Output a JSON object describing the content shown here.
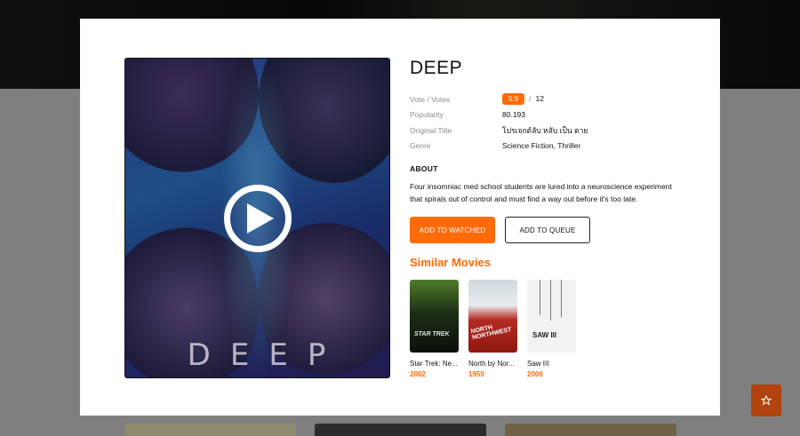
{
  "movie": {
    "title": "DEEP",
    "poster_title": "DEEP",
    "vote_label": "Vote / Votes",
    "vote": "5.9",
    "vote_separator": "/",
    "votes": "12",
    "popularity_label": "Popularity",
    "popularity": "80.193",
    "original_title_label": "Original Title",
    "original_title": "โปรเจกต์ลับ หลับ เป็น ตาย",
    "genre_label": "Genre",
    "genre": "Science Fiction, Thriller",
    "about_label": "ABOUT",
    "about": "Four insomniac med school students are lured into a neuroscience experiment that spirals out of control and must find a way out before it's too late."
  },
  "actions": {
    "watched": "ADD TO WATCHED",
    "queue": "ADD TO QUEUE"
  },
  "similar": {
    "heading": "Similar Movies",
    "items": [
      {
        "title": "Star Trek: Ne...",
        "year": "2002",
        "poster_text": "STAR TREK"
      },
      {
        "title": "North by Nor...",
        "year": "1959",
        "poster_text": "NORTH NORTHWEST"
      },
      {
        "title": "Saw III",
        "year": "2006",
        "poster_text": "SAW III"
      }
    ]
  },
  "colors": {
    "accent": "#ff6b08",
    "fab": "#b0430e"
  },
  "icons": {
    "play": "play-icon",
    "fab": "star-icon"
  }
}
